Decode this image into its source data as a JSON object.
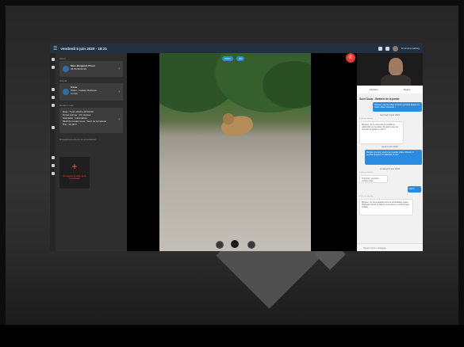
{
  "app": {
    "title": "vendredi 5 juin 2020 - 18:21",
    "menu_icon": "☰",
    "user_name": "Dr Emma Hartley"
  },
  "left_panel": {
    "section1_label": "Client",
    "client_name": "Marc-Benjamin Prieur",
    "client_sub": "06 56 60 00 00",
    "section2_label": "Animal",
    "animal_name": "Oscar",
    "animal_line1": "Chien - Golden Retriever",
    "animal_line2": "3 mois",
    "section3_label": "Rendez-vous",
    "appt_lines": [
      "Date : 5 juin 2020 à 18:00:00",
      "Durée prévue : 15 minutes",
      "Spécialité : Généraliste",
      "Motif du rendez-vous : Suivi de la boiterie",
      "Prix : 40,00 €"
    ],
    "section4_label": "Enregistrements de la consultation",
    "record_plus": "+",
    "record_label": "Enregistrer la vidéo de la consultation"
  },
  "video": {
    "pill1": "Vidéo",
    "pill2": "HD"
  },
  "chat": {
    "tab1": "Fichiers",
    "tab2": "Notes",
    "title": "Suivi Oscar - Boiterie de la jambe",
    "messages": [
      {
        "type": "out",
        "text": "Bonjour, voici la vidéo d'Oscar qui boite depuis ce matin. Merci d'avance !"
      },
      {
        "type": "date",
        "text": "mercredi 3 juin 2020"
      },
      {
        "type": "meta",
        "text": "Dr Emma Hartley"
      },
      {
        "type": "in",
        "text": "Bonjour, Je ne vois pas de problème particulier sur la vidéo. Pouvez-vous me montrer sa patte en visio ?"
      },
      {
        "type": "date",
        "text": "jeudi 4 juin 2020"
      },
      {
        "type": "out",
        "text": "Bonjour docteur, voici une nouvelle vidéo d'Oscar. Il semble toujours en difficulté ce soir."
      },
      {
        "type": "date",
        "text": "vendredi 5 juin 2020"
      },
      {
        "type": "meta",
        "text": "Dr Emma Hartley"
      },
      {
        "type": "in",
        "text": "Très bien, prenons rendez-vous."
      },
      {
        "type": "out",
        "text": "Merci"
      },
      {
        "type": "meta",
        "text": "Dr Emma Hartley"
      },
      {
        "type": "in",
        "text": "Bonjour, Je vous attends pour la consultation vidéo. Préparez Oscar et placez-vous dans un endroit bien éclairé."
      }
    ],
    "input_placeholder": "Tapez votre message"
  }
}
